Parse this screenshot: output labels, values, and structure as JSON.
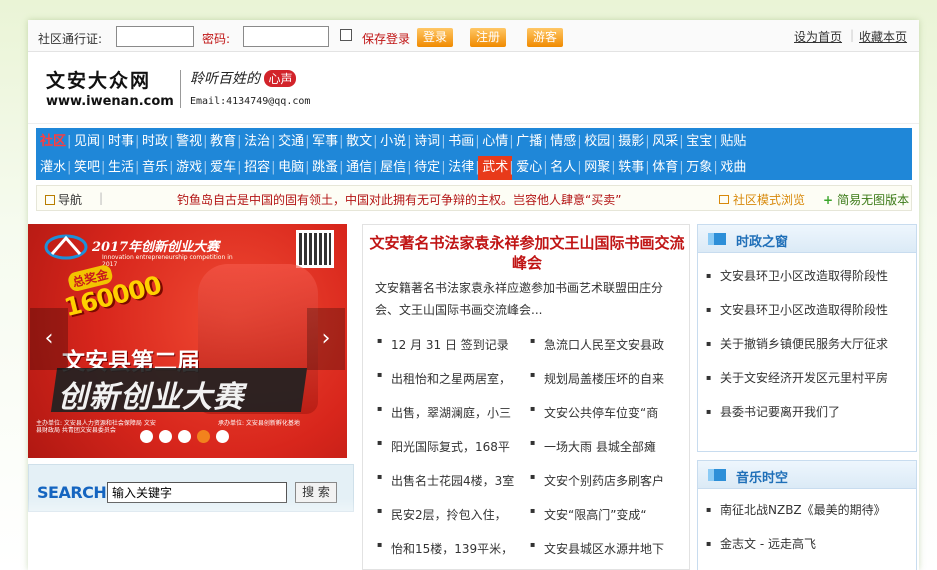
{
  "topbar": {
    "username_label": "社区通行证:",
    "password_label": "密码:",
    "remember_label": "保存登录",
    "login_btn": "登录",
    "register_btn": "注册",
    "guest_btn": "游客",
    "set_home": "设为首页",
    "add_fav": "收藏本页"
  },
  "header": {
    "site_name": "文安大众网",
    "site_url": "www.iwenan.com",
    "slogan": "聆听百姓的",
    "slogan_heart": "心声",
    "email": "Email:4134749@qq.com"
  },
  "nav": {
    "row1": [
      "社区",
      "见闻",
      "时事",
      "时政",
      "警视",
      "教育",
      "法治",
      "交通",
      "军事",
      "散文",
      "小说",
      "诗词",
      "书画",
      "心情",
      "广播",
      "情感",
      "校园",
      "摄影",
      "风采",
      "宝宝",
      "贴贴"
    ],
    "row2": [
      "灌水",
      "笑吧",
      "生活",
      "音乐",
      "游戏",
      "爱车",
      "招容",
      "电脑",
      "跳蚤",
      "通信",
      "屋信",
      "待定",
      "法律",
      "武术",
      "爱心",
      "名人",
      "网聚",
      "轶事",
      "体育",
      "万象",
      "戏曲"
    ]
  },
  "guide": {
    "label": "导航",
    "notice": "钓鱼岛自古是中国的固有领土，中国对此拥有无可争辩的主权。岂容他人肆意“买卖”",
    "mode_link": "社区模式浏览",
    "simple_link": "简易无图版本"
  },
  "banner": {
    "header": "2017年创新创业大赛",
    "header_sub": "Innovation entrepreneurship competition in 2017",
    "prize_label": "总奖金",
    "prize_value": "160000",
    "line1": "文安县第二届",
    "line2": "创新创业大赛",
    "organizer": "主办单位: 文安县人力资源和社会保障局 文安县财政局 共青团文安县委员会",
    "undertaker": "承办单位: 文安县创新孵化基地"
  },
  "search": {
    "logo": "SEARCH",
    "placeholder": "输入关键字",
    "button": "搜 索"
  },
  "headline": {
    "title": "文安著名书法家袁永祥参加文王山国际书画交流峰会",
    "summary": "文安籍著名书法家袁永祥应邀参加书画艺术联盟田庄分会、文王山国际书画交流峰会..."
  },
  "news_list": [
    [
      "12 月 31 日 签到记录",
      "急流口人民至文安县政"
    ],
    [
      "出租怡和之星两居室，",
      "规划局盖楼压坏的自来"
    ],
    [
      "出售，翠湖澜庭，小三",
      "文安公共停车位变“商"
    ],
    [
      "阳光国际复式，168平",
      "一场大雨 县城全部瘫"
    ],
    [
      "出售名士花园4楼，3室",
      "文安个别药店多刷客户"
    ],
    [
      "民安2层，拎包入住，",
      "文安“限高门”变成“"
    ],
    [
      "怡和15楼，139平米，",
      "文安县城区水源井地下"
    ]
  ],
  "sidebar": {
    "section1_title": "时政之窗",
    "section1_items": [
      "文安县环卫小区改造取得阶段性",
      "文安县环卫小区改造取得阶段性",
      "关于撤销乡镇便民服务大厅征求",
      "关于文安经济开发区元里村平房",
      "县委书记要离开我们了"
    ],
    "section2_title": "音乐时空",
    "section2_items": [
      "南征北战NZBZ《最美的期待》",
      "金志文 - 远走高飞"
    ]
  },
  "colors": {
    "nav_bg": "#1f87d8",
    "accent_red": "#c01414",
    "button_orange": "#f08a00"
  }
}
